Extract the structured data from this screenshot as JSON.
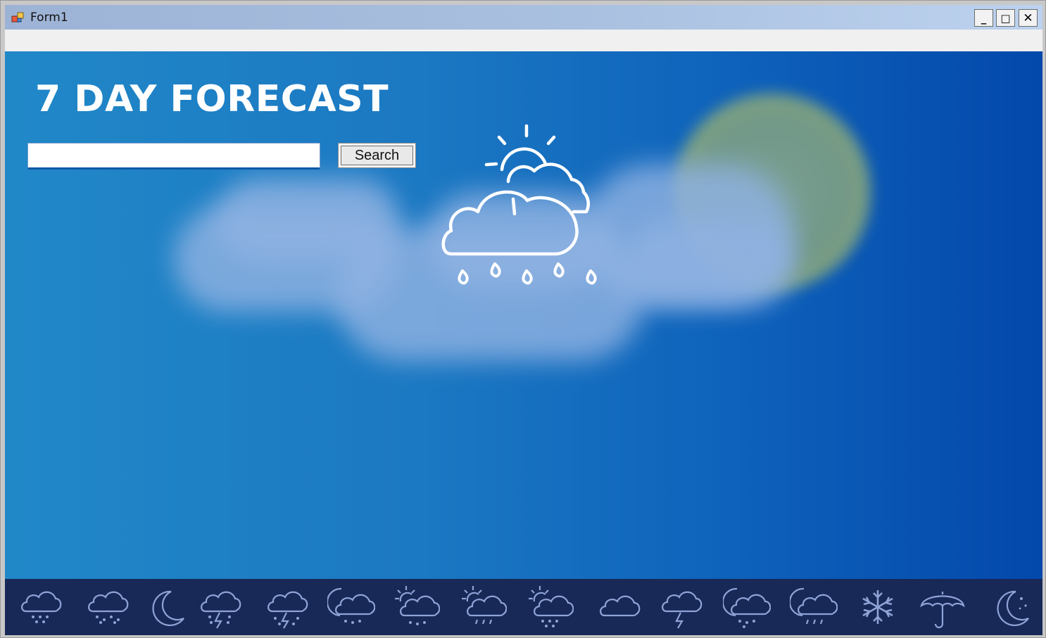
{
  "window": {
    "title": "Form1",
    "controls": {
      "minimize": "_",
      "maximize": "□",
      "close": "✕"
    }
  },
  "app": {
    "heading": "7 DAY FORECAST",
    "search": {
      "value": "",
      "placeholder": "",
      "button_label": "Search"
    },
    "main_icon": "cloud-sun-rain-icon"
  },
  "icon_strip": [
    "cloud-sleet-icon",
    "cloud-snow-icon",
    "moon-icon",
    "cloud-lightning-snow-icon",
    "cloud-lightning-snow-icon",
    "moon-cloud-sleet-icon",
    "sun-cloud-sleet-icon",
    "sun-cloud-rain-icon",
    "sun-cloud-snow-icon",
    "cloud-icon",
    "cloud-lightning-icon",
    "moon-cloud-snow-icon",
    "moon-cloud-rain-icon",
    "snowflake-icon",
    "umbrella-icon",
    "moon-stars-icon"
  ],
  "colors": {
    "client_gradient_start": "#2188c8",
    "client_gradient_end": "#0348ab",
    "strip_background": "#182957",
    "strip_icon": "#8fa3d6",
    "heading_text": "#ffffff"
  }
}
